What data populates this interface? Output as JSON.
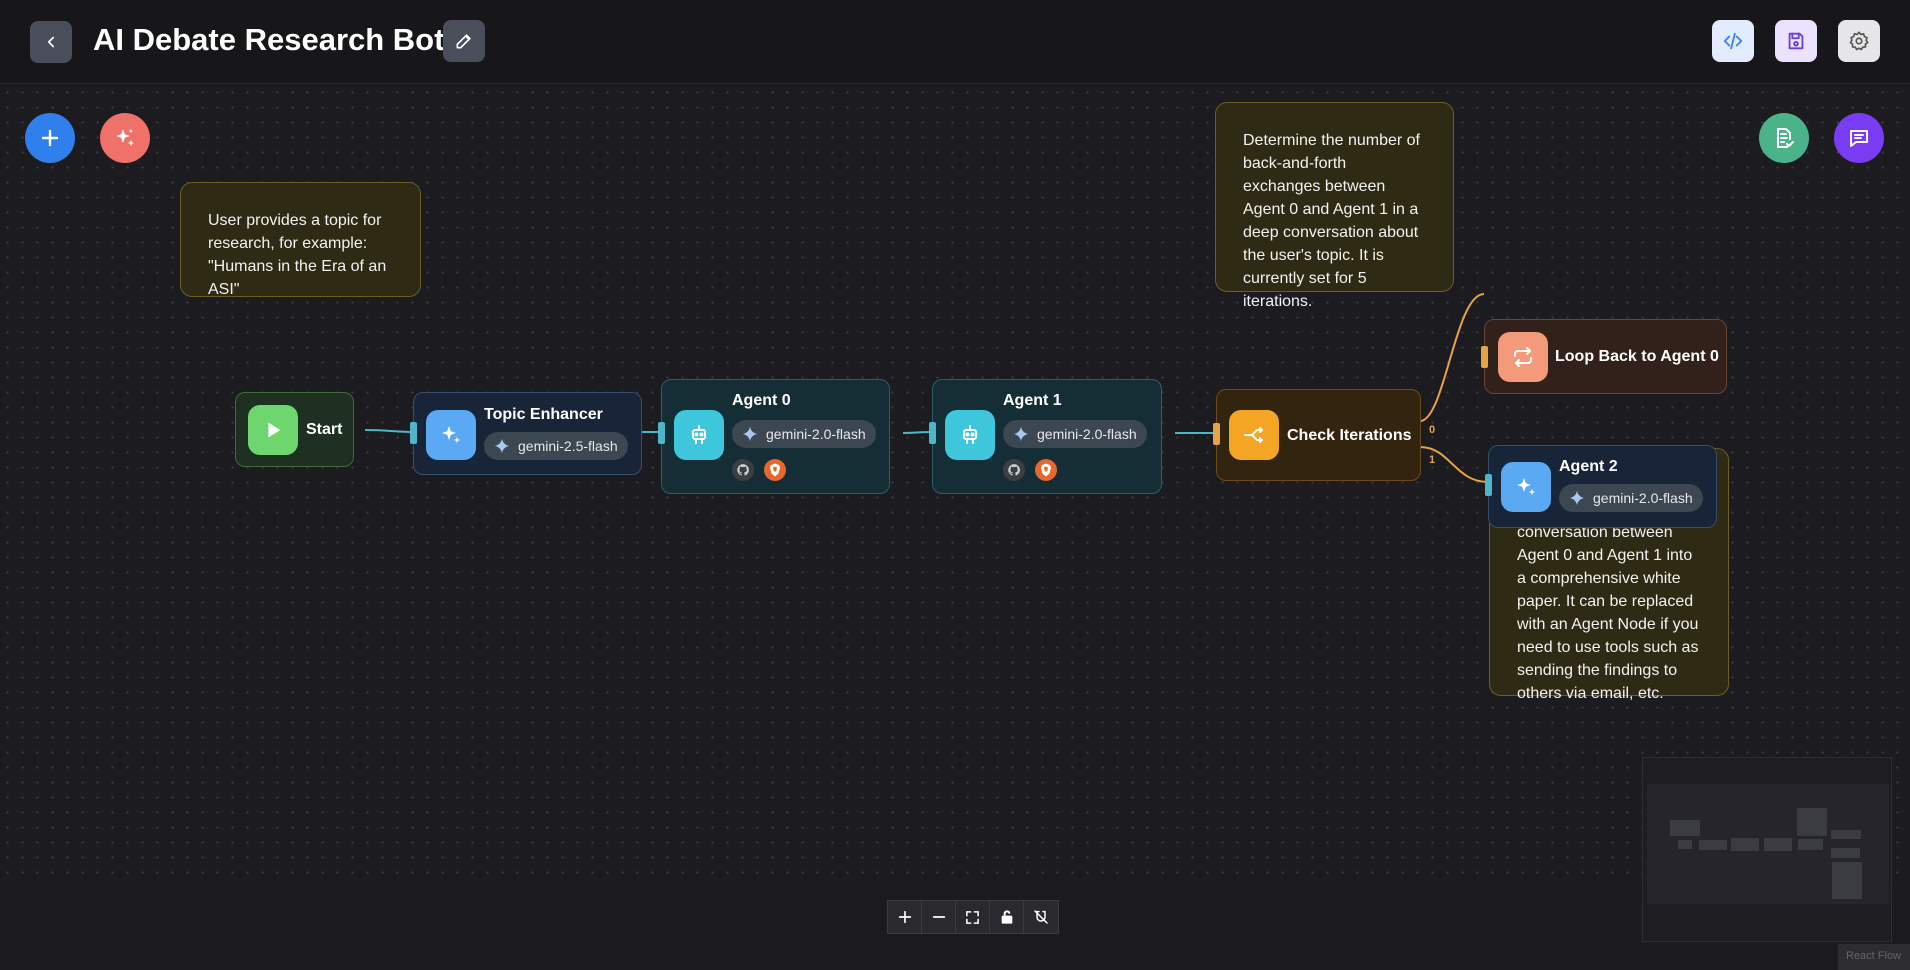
{
  "header": {
    "title": "AI Debate Research Bot",
    "back_icon": "chevron-left-icon",
    "edit_icon": "pencil-icon",
    "actions": [
      {
        "name": "code-button",
        "icon": "code-icon",
        "bg": "#e3ecff",
        "color": "#3b82f6"
      },
      {
        "name": "save-button",
        "icon": "save-icon",
        "bg": "#ebe2ff",
        "color": "#6d3fd6"
      },
      {
        "name": "settings-button",
        "icon": "gear-icon",
        "bg": "#e6e6e9",
        "color": "#555"
      }
    ]
  },
  "fabs": {
    "add_icon": "plus-icon",
    "ai_icon": "sparkles-icon",
    "validate_icon": "clipboard-check-icon",
    "chat_icon": "chat-icon",
    "colors": {
      "add": "#2f80ed",
      "ai": "#f0706a",
      "validate": "#4bb38a",
      "chat": "#7a3cf2"
    }
  },
  "notes": {
    "start_note": "User provides a topic for research, for example: \"Humans in the Era of an ASI\"",
    "iterations_note": "Determine the number of back-and-forth exchanges between Agent 0 and Agent 1 in a deep conversation about the user's topic. It is currently set for 5 iterations.",
    "llm_note": "This LLM Node transforms the in-depth conversation between Agent 0 and Agent 1 into a comprehensive white paper. It can be replaced with an Agent Node if you need to use tools such as sending the findings to others via email, etc."
  },
  "nodes": {
    "start": {
      "title": "Start",
      "icon": "play-icon"
    },
    "topic_enhancer": {
      "title": "Topic Enhancer",
      "icon": "sparkles-icon",
      "model": "gemini-2.5-flash"
    },
    "agent0": {
      "title": "Agent 0",
      "icon": "robot-icon",
      "model": "gemini-2.0-flash",
      "tools": [
        "github-icon",
        "brave-icon"
      ]
    },
    "agent1": {
      "title": "Agent 1",
      "icon": "robot-icon",
      "model": "gemini-2.0-flash",
      "tools": [
        "github-icon",
        "brave-icon"
      ]
    },
    "check_iterations": {
      "title": "Check Iterations",
      "icon": "condition-icon",
      "out0": "0",
      "out1": "1"
    },
    "loop_back": {
      "title": "Loop Back to Agent 0",
      "icon": "loop-icon"
    },
    "agent2": {
      "title": "Agent 2",
      "icon": "sparkles-icon",
      "model": "gemini-2.0-flash"
    }
  },
  "controls": [
    "zoom-in-icon",
    "zoom-out-icon",
    "fit-view-icon",
    "lock-icon",
    "magnet-off-icon"
  ],
  "attribution": "React Flow"
}
